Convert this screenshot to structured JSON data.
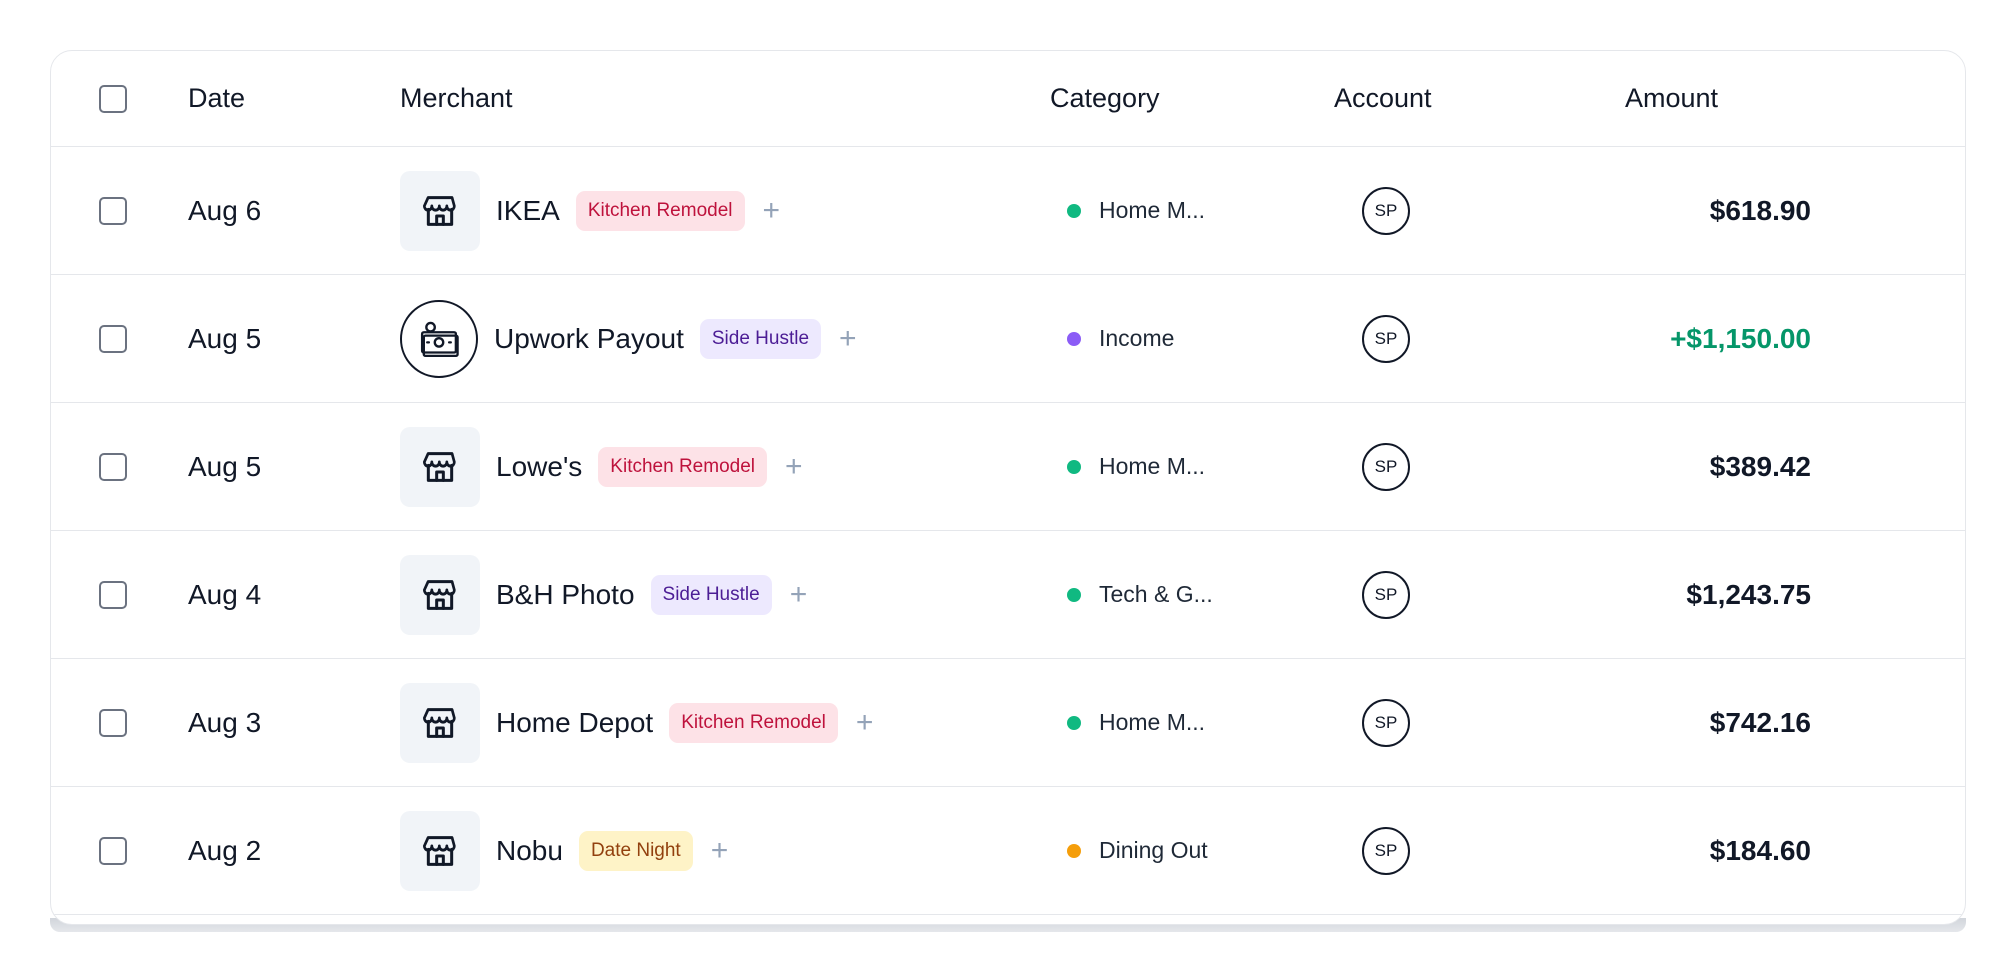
{
  "header": {
    "date": "Date",
    "merchant": "Merchant",
    "category": "Category",
    "account": "Account",
    "amount": "Amount"
  },
  "rows": [
    {
      "date": "Aug 6",
      "merchant": "IKEA",
      "icon": "store-icon",
      "tag": "Kitchen Remodel",
      "tag_bg": "#fde2e7",
      "tag_color": "#be123c",
      "category": "Home M...",
      "category_color": "#10b981",
      "account": "SP",
      "amount": "$618.90",
      "positive": false
    },
    {
      "date": "Aug 5",
      "merchant": "Upwork Payout",
      "icon": "cash-icon",
      "tag": "Side Hustle",
      "tag_bg": "#ede9fe",
      "tag_color": "#4c1d95",
      "category": "Income",
      "category_color": "#8b5cf6",
      "account": "SP",
      "amount": "+$1,150.00",
      "positive": true
    },
    {
      "date": "Aug 5",
      "merchant": "Lowe's",
      "icon": "store-icon",
      "tag": "Kitchen Remodel",
      "tag_bg": "#fde2e7",
      "tag_color": "#be123c",
      "category": "Home M...",
      "category_color": "#10b981",
      "account": "SP",
      "amount": "$389.42",
      "positive": false
    },
    {
      "date": "Aug 4",
      "merchant": "B&H Photo",
      "icon": "store-icon",
      "tag": "Side Hustle",
      "tag_bg": "#ede9fe",
      "tag_color": "#4c1d95",
      "category": "Tech & G...",
      "category_color": "#10b981",
      "account": "SP",
      "amount": "$1,243.75",
      "positive": false
    },
    {
      "date": "Aug 3",
      "merchant": "Home Depot",
      "icon": "store-icon",
      "tag": "Kitchen Remodel",
      "tag_bg": "#fde2e7",
      "tag_color": "#be123c",
      "category": "Home M...",
      "category_color": "#10b981",
      "account": "SP",
      "amount": "$742.16",
      "positive": false
    },
    {
      "date": "Aug 2",
      "merchant": "Nobu",
      "icon": "store-icon",
      "tag": "Date Night",
      "tag_bg": "#fef3c7",
      "tag_color": "#92400e",
      "category": "Dining Out",
      "category_color": "#f59e0b",
      "account": "SP",
      "amount": "$184.60",
      "positive": false
    }
  ]
}
